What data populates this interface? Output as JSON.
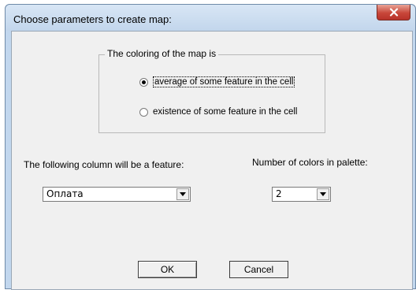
{
  "dialog": {
    "title": "Choose parameters to create map:",
    "close_icon": "close-icon"
  },
  "coloring_group": {
    "legend": "The coloring of the map is",
    "options": [
      {
        "label": "average of some feature in the cell",
        "selected": true
      },
      {
        "label": "existence of some feature in the cell",
        "selected": false
      }
    ]
  },
  "feature": {
    "label": "The following column will be a feature:",
    "selected": "Оплата"
  },
  "palette": {
    "label": "Number of colors in palette:",
    "selected": "2"
  },
  "buttons": {
    "ok": "OK",
    "cancel": "Cancel"
  }
}
